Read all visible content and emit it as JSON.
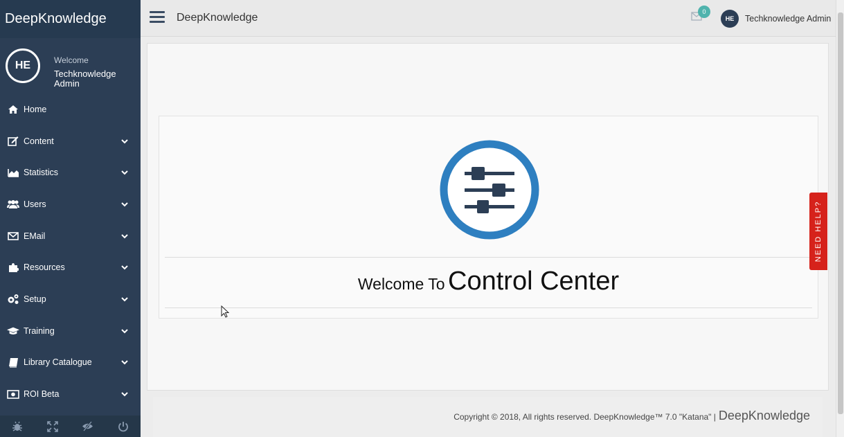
{
  "sidebar": {
    "brand": "DeepKnowledge",
    "profile": {
      "initials": "HE",
      "welcome": "Welcome",
      "name": "Techknowledge Admin"
    },
    "items": [
      {
        "label": "Home",
        "icon": "home-icon"
      },
      {
        "label": "Content",
        "icon": "edit-icon"
      },
      {
        "label": "Statistics",
        "icon": "chart-icon"
      },
      {
        "label": "Users",
        "icon": "users-icon"
      },
      {
        "label": "EMail",
        "icon": "envelope-icon"
      },
      {
        "label": "Resources",
        "icon": "puzzle-icon"
      },
      {
        "label": "Setup",
        "icon": "cogs-icon"
      },
      {
        "label": "Training",
        "icon": "graduation-cap-icon"
      },
      {
        "label": "Library Catalogue",
        "icon": "book-icon"
      },
      {
        "label": "ROI Beta",
        "icon": "money-icon"
      }
    ],
    "footer_icons": [
      "bug-icon",
      "fullscreen-icon",
      "eye-slash-icon",
      "power-icon"
    ]
  },
  "topbar": {
    "title": "DeepKnowledge",
    "mail_count": "0",
    "user_initials": "HE",
    "user_name": "Techknowledge Admin"
  },
  "main": {
    "welcome_prefix": "Welcome To",
    "welcome_title": "Control Center"
  },
  "footer": {
    "copyright": "Copyright © 2018, All rights reserved. DeepKnowledge™ 7.0 \"Katana\" |",
    "brand": "DeepKnowledge"
  },
  "help_tab": "NEED HELP?",
  "colors": {
    "sidebar_bg": "#2c3e55",
    "accent_blue": "#2e7fc0",
    "help_red": "#d6221b",
    "badge_teal": "#4fb3ad"
  }
}
